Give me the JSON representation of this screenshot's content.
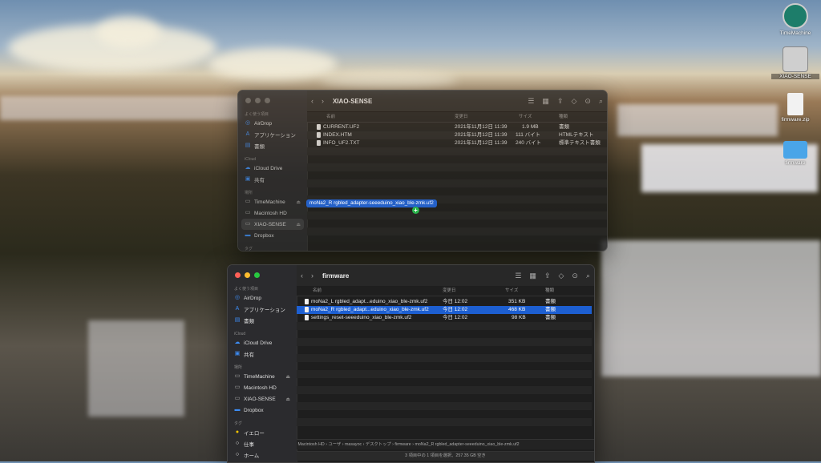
{
  "desktop": {
    "icons": [
      {
        "label": "TimeMachine"
      },
      {
        "label": "XIAO-SENSE"
      },
      {
        "label": "firmware.zip"
      },
      {
        "label": "firmware"
      }
    ]
  },
  "back_window": {
    "title": "XIAO-SENSE",
    "sidebar": {
      "favorites_header": "よく使う項目",
      "favorites": [
        {
          "label": "AirDrop",
          "icon": "airdrop-icon"
        },
        {
          "label": "アプリケーション",
          "icon": "applications-icon"
        },
        {
          "label": "書類",
          "icon": "documents-icon"
        }
      ],
      "icloud_header": "iCloud",
      "icloud": [
        {
          "label": "iCloud Drive",
          "icon": "cloud-icon"
        },
        {
          "label": "共有",
          "icon": "shared-icon"
        }
      ],
      "locations_header": "場所",
      "locations": [
        {
          "label": "TimeMachine",
          "icon": "disk-icon"
        },
        {
          "label": "Macintosh HD",
          "icon": "disk-icon"
        },
        {
          "label": "XIAO-SENSE",
          "icon": "disk-icon"
        },
        {
          "label": "Dropbox",
          "icon": "folder-icon"
        }
      ],
      "tags_header": "タグ"
    },
    "columns": {
      "name": "名前",
      "date": "変更日",
      "size": "サイズ",
      "kind": "種類"
    },
    "files": [
      {
        "name": "CURRENT.UF2",
        "date": "2021年11月12日 11:39",
        "size": "1.9 MB",
        "kind": "書類"
      },
      {
        "name": "INDEX.HTM",
        "date": "2021年11月12日 11:39",
        "size": "111 バイト",
        "kind": "HTMLテキスト"
      },
      {
        "name": "INFO_UF2.TXT",
        "date": "2021年11月12日 11:39",
        "size": "240 バイト",
        "kind": "標準テキスト書類"
      }
    ]
  },
  "drag": {
    "label": "moNa2_R rgbled_adapter-seeeduino_xiao_ble-zmk.uf2",
    "badge": "+"
  },
  "front_window": {
    "title": "firmware",
    "sidebar": {
      "favorites_header": "よく使う項目",
      "favorites": [
        {
          "label": "AirDrop",
          "icon": "airdrop-icon"
        },
        {
          "label": "アプリケーション",
          "icon": "applications-icon"
        },
        {
          "label": "書類",
          "icon": "documents-icon"
        }
      ],
      "icloud_header": "iCloud",
      "icloud": [
        {
          "label": "iCloud Drive",
          "icon": "cloud-icon"
        },
        {
          "label": "共有",
          "icon": "shared-icon"
        }
      ],
      "locations_header": "場所",
      "locations": [
        {
          "label": "TimeMachine",
          "icon": "disk-icon"
        },
        {
          "label": "Macintosh HD",
          "icon": "disk-icon"
        },
        {
          "label": "XIAO-SENSE",
          "icon": "disk-icon"
        },
        {
          "label": "Dropbox",
          "icon": "folder-icon"
        }
      ],
      "tags_header": "タグ",
      "tags": [
        {
          "label": "イエロー",
          "color": "#f5c400"
        },
        {
          "label": "仕事",
          "color": "#ffffff"
        },
        {
          "label": "ホーム",
          "color": "#ffffff"
        }
      ]
    },
    "columns": {
      "name": "名前",
      "date": "変更日",
      "size": "サイズ",
      "kind": "種類"
    },
    "files": [
      {
        "name": "moNa2_L rgbled_adapt...eduino_xiao_ble-zmk.uf2",
        "date": "今日 12:02",
        "size": "351 KB",
        "kind": "書類",
        "selected": false
      },
      {
        "name": "moNa2_R rgbled_adapt...eduino_xiao_ble-zmk.uf2",
        "date": "今日 12:02",
        "size": "468 KB",
        "kind": "書類",
        "selected": true
      },
      {
        "name": "settings_reset-seeeduino_xiao_ble-zmk.uf2",
        "date": "今日 12:02",
        "size": "98 KB",
        "kind": "書類",
        "selected": false
      }
    ],
    "path": [
      "Macintosh HD",
      "ユーザ",
      "masayoc",
      "デスクトップ",
      "firmware",
      "moNa2_R rgbled_adapter-seeeduino_xiao_ble-zmk.uf2"
    ],
    "status": "3 項目中の 1 項目を選択、257.35 GB 空き"
  }
}
